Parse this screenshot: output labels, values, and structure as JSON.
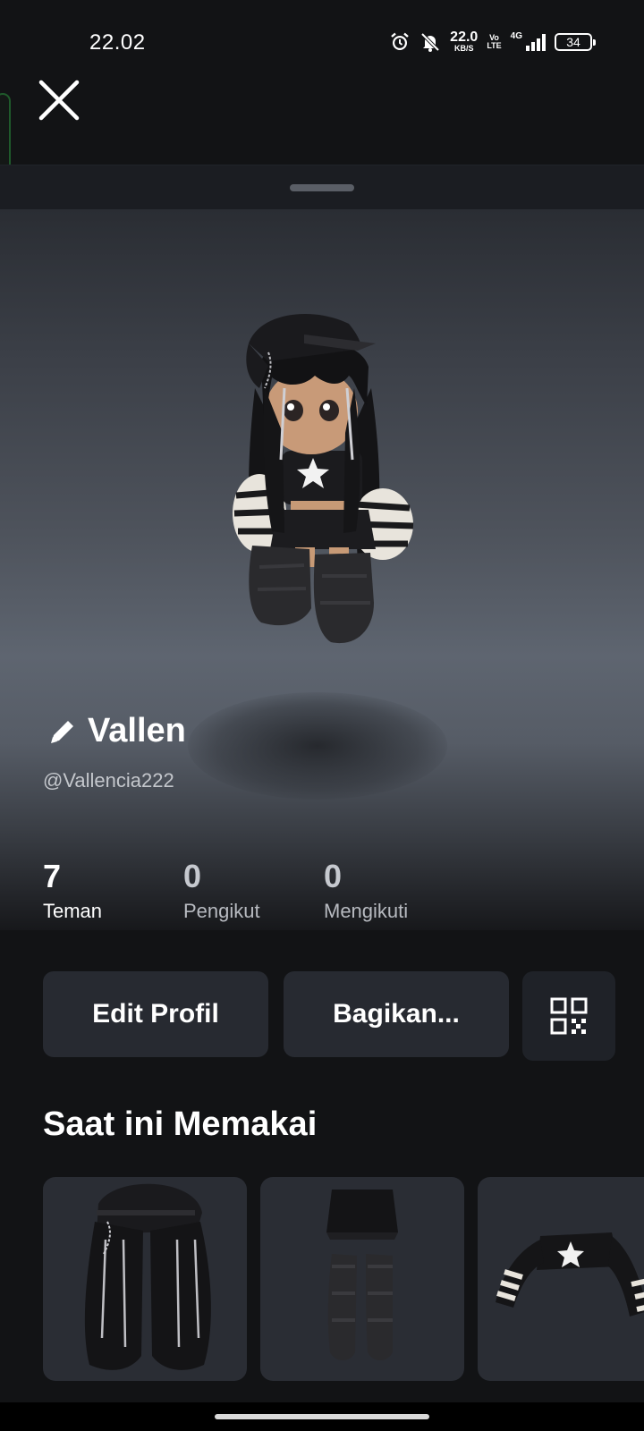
{
  "status_bar": {
    "time": "22.02",
    "net_speed": "22.0",
    "net_unit": "KB/S",
    "volte_top": "Vo",
    "volte_bottom": "LTE",
    "network_type": "4G",
    "battery": "34",
    "icons": [
      "alarm-icon",
      "mute-icon",
      "signal-icon",
      "battery-icon"
    ]
  },
  "header": {
    "close_icon": "close-icon"
  },
  "profile": {
    "display_name": "Vallen",
    "edit_icon": "pencil-icon",
    "username": "@Vallencia222"
  },
  "stats": [
    {
      "value": "7",
      "label": "Teman"
    },
    {
      "value": "0",
      "label": "Pengikut"
    },
    {
      "value": "0",
      "label": "Mengikuti"
    }
  ],
  "actions": {
    "edit_profile": "Edit Profil",
    "share": "Bagikan...",
    "qr_icon": "qr-code-icon"
  },
  "wearing": {
    "title": "Saat ini Memakai",
    "items": [
      "hair-item",
      "skirt-legwarmers-item",
      "sweater-item"
    ]
  },
  "colors": {
    "background": "#121315",
    "card": "#272a31",
    "text_muted": "#b7bac0"
  }
}
